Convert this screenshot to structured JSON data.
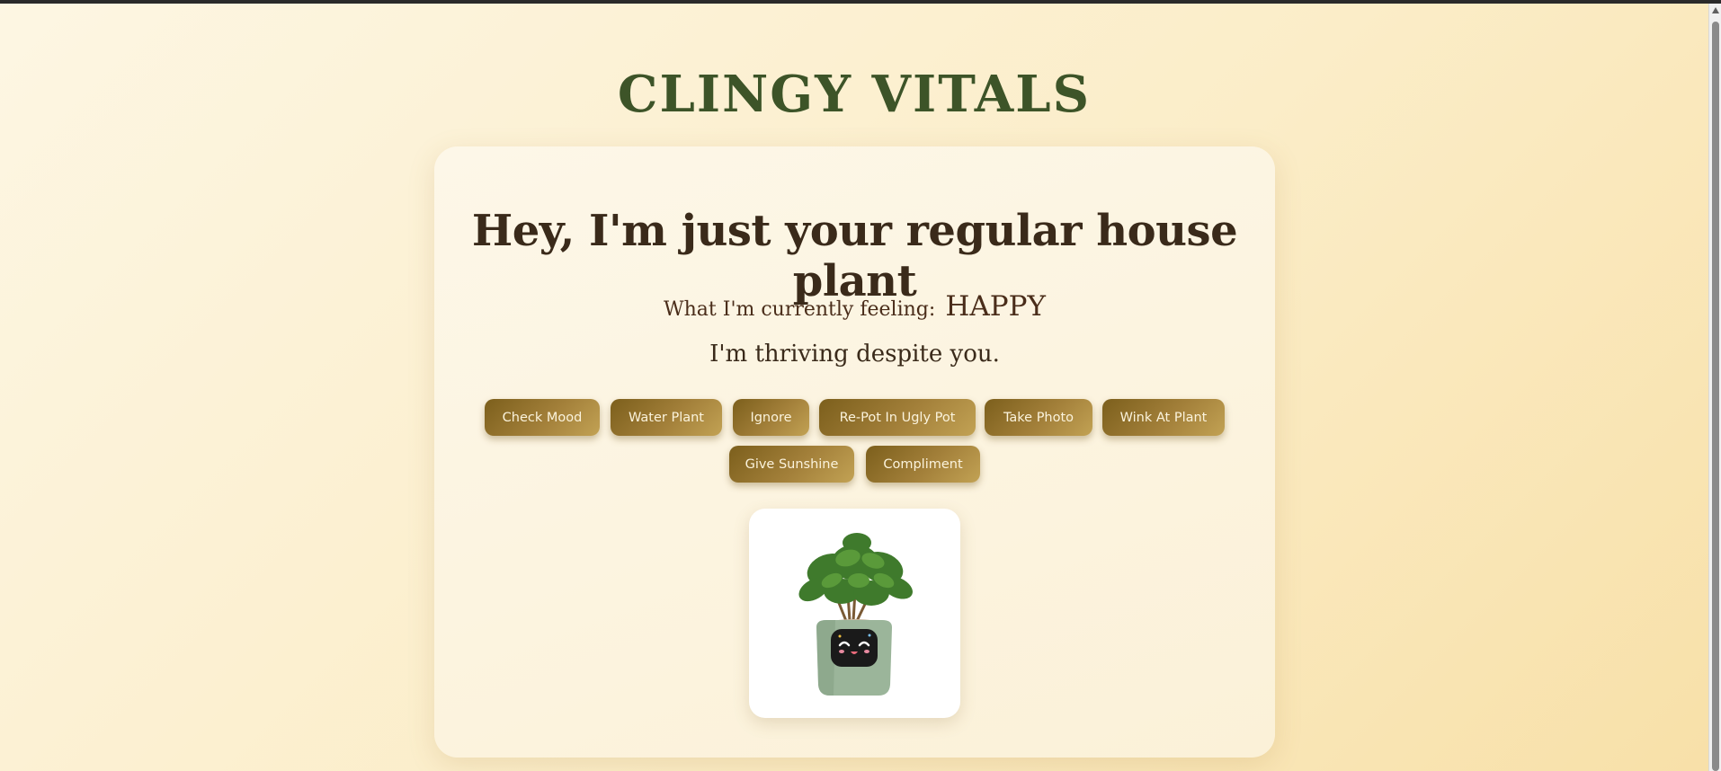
{
  "app": {
    "title": "Clingy Vitals"
  },
  "card": {
    "headline": "Hey, I'm just your regular house plant",
    "mood_label": "What I'm currently feeling:",
    "mood_value": "HAPPY",
    "status": "I'm thriving despite you."
  },
  "actions": [
    {
      "label": "Check Mood"
    },
    {
      "label": "Water Plant"
    },
    {
      "label": "Ignore"
    },
    {
      "label": "Re-Pot In Ugly Pot"
    },
    {
      "label": "Take Photo"
    },
    {
      "label": "Wink At Plant"
    },
    {
      "label": "Give Sunshine"
    },
    {
      "label": "Compliment"
    }
  ],
  "image": {
    "icon": "potted-plant-with-face-icon"
  },
  "colors": {
    "title": "#3d5428",
    "button_start": "#7c5f1c",
    "button_end": "#c2a254",
    "background": "#fbedc8"
  }
}
